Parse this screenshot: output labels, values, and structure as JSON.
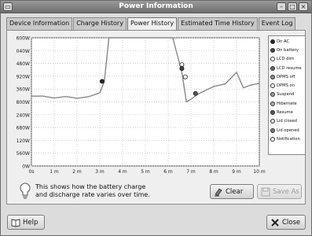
{
  "window": {
    "title": "Power Information"
  },
  "tabs": [
    {
      "label": "Device Information",
      "active": false
    },
    {
      "label": "Charge History",
      "active": false
    },
    {
      "label": "Power History",
      "active": true
    },
    {
      "label": "Estimated Time History",
      "active": false
    },
    {
      "label": "Event Log",
      "active": false
    }
  ],
  "info": {
    "line1": "This shows how the battery charge",
    "line2": "and discharge rate varies over time."
  },
  "buttons": {
    "clear": "Clear",
    "save_as": "Save As",
    "help": "Help",
    "close": "Close"
  },
  "legend": [
    {
      "label": "On AC",
      "color": "#222222"
    },
    {
      "label": "On battery",
      "color": "#444444"
    },
    {
      "label": "LCD dim",
      "color": "#ffffff"
    },
    {
      "label": "LCD resume",
      "color": "#666666"
    },
    {
      "label": "DPMS off",
      "color": "#888888"
    },
    {
      "label": "DPMS on",
      "color": "#ffffff"
    },
    {
      "label": "Suspend",
      "color": "#999999"
    },
    {
      "label": "Hibernate",
      "color": "#aaaaaa"
    },
    {
      "label": "Resume",
      "color": "#555555"
    },
    {
      "label": "Lid closed",
      "color": "#dddddd"
    },
    {
      "label": "Lid opened",
      "color": "#777777"
    },
    {
      "label": "Notification",
      "color": "#ffffff"
    }
  ],
  "chart_data": {
    "type": "line",
    "y_ticks": [
      "600W",
      "040W",
      "480W",
      "920W",
      "360W",
      "800W",
      "240W",
      "680W",
      "120W",
      "560W",
      "0W"
    ],
    "x_ticks": [
      "0s",
      "1 m",
      "2 m",
      "3 m",
      "4 m",
      "5 m",
      "6 m",
      "7 m",
      "8 m",
      "9 m",
      "10 m"
    ],
    "xlim": [
      0,
      10
    ],
    "ylim": [
      0,
      10
    ],
    "grid": true,
    "series": [
      {
        "color": "#888888",
        "x": [
          0,
          0.5,
          1,
          1.5,
          2,
          2.5,
          3,
          3.2,
          3.4,
          6.0,
          6.2,
          6.6,
          6.8,
          7.0,
          7.3,
          8.0,
          8.5,
          9.0,
          9.3,
          9.6,
          10.0
        ],
        "y": [
          5.45,
          5.45,
          5.3,
          5.42,
          5.28,
          5.4,
          5.7,
          6.6,
          10.0,
          10.0,
          10.0,
          7.3,
          5.0,
          5.2,
          5.6,
          6.2,
          6.4,
          7.3,
          6.1,
          6.3,
          6.45
        ]
      }
    ],
    "events": [
      {
        "x": 3.1,
        "y": 6.6,
        "legend": "On AC"
      },
      {
        "x": 6.6,
        "y": 7.9,
        "legend": "LCD dim"
      },
      {
        "x": 6.6,
        "y": 7.6,
        "legend": "On battery"
      },
      {
        "x": 6.75,
        "y": 6.95,
        "legend": "DPMS on"
      },
      {
        "x": 7.2,
        "y": 5.65,
        "legend": "Resume"
      }
    ]
  }
}
